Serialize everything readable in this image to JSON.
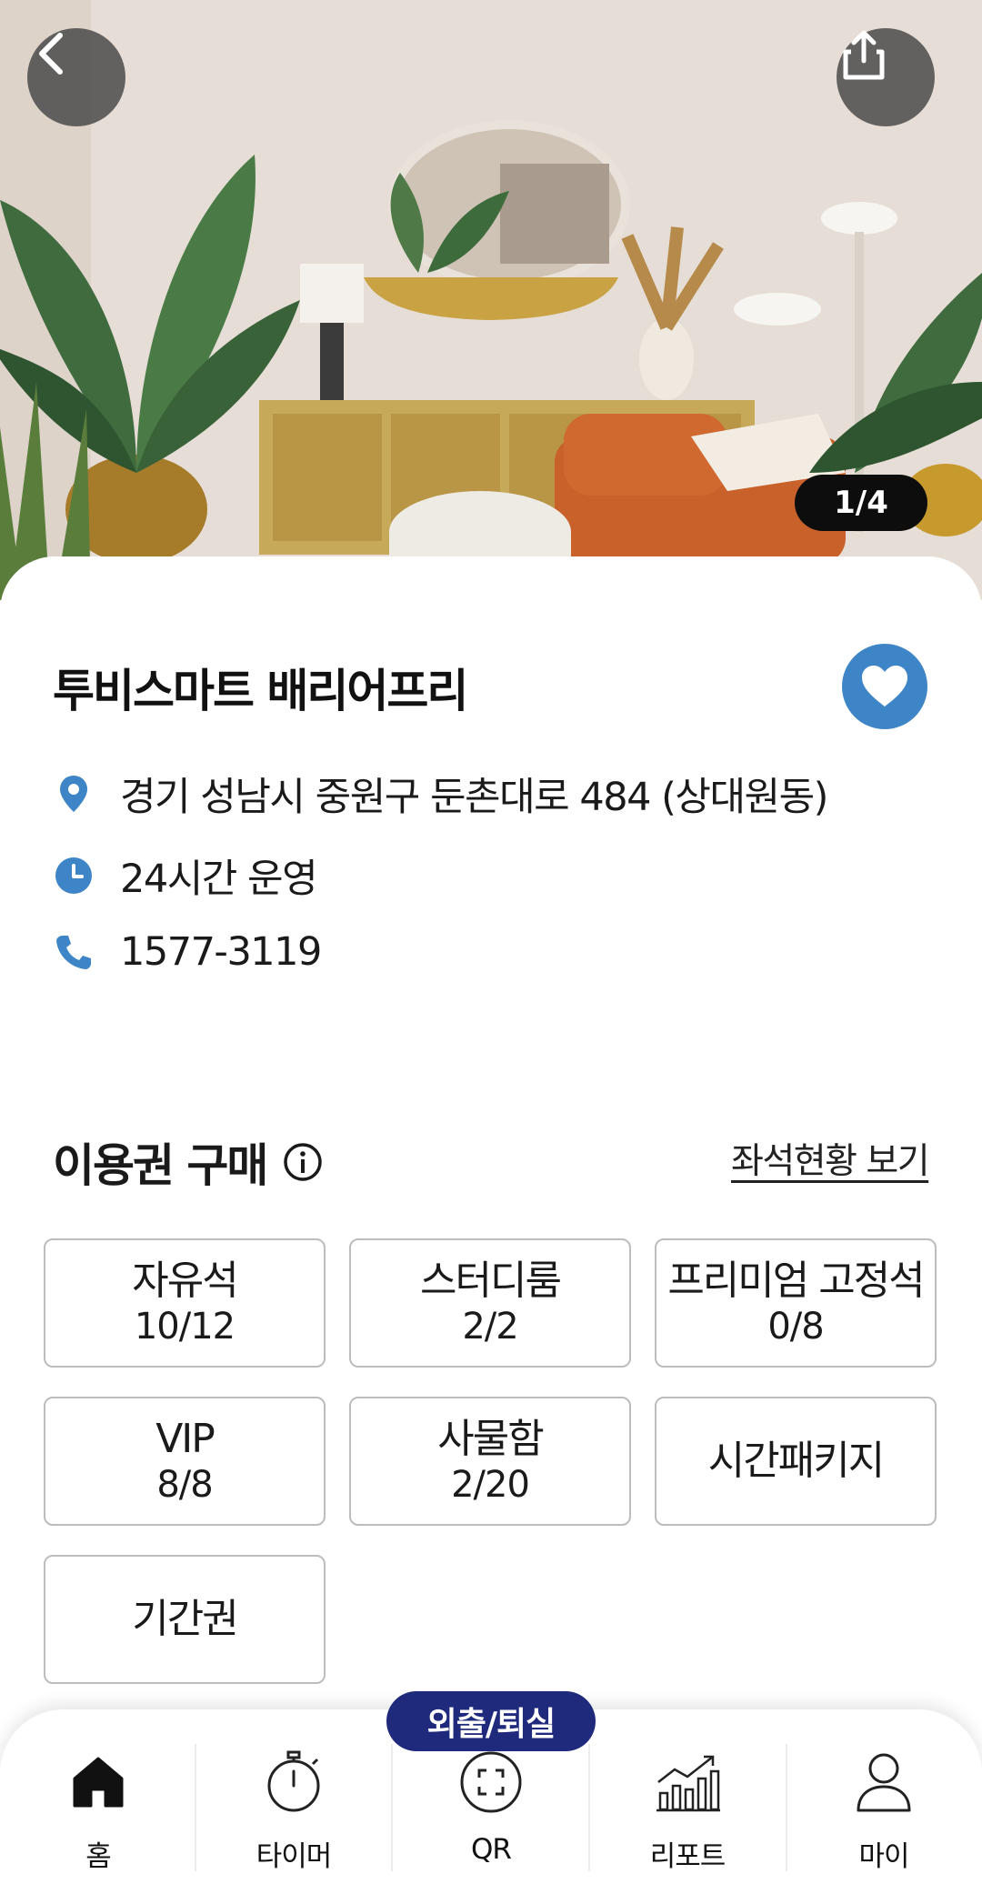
{
  "hero": {
    "page_indicator": "1/4",
    "icons": {
      "back": "chevron-left-icon",
      "share": "share-icon"
    }
  },
  "store": {
    "name": "투비스마트 배리어프리",
    "address": "경기 성남시 중원구 둔촌대로 484 (상대원동)",
    "hours": "24시간 운영",
    "phone": "1577-3119",
    "icons": {
      "address": "location-pin-icon",
      "hours": "clock-icon",
      "phone": "phone-icon",
      "favorite": "heart-icon"
    }
  },
  "purchase": {
    "title": "이용권 구매",
    "seat_status_link": "좌석현황 보기",
    "tickets": [
      {
        "name": "자유석",
        "count": "10/12"
      },
      {
        "name": "스터디룸",
        "count": "2/2"
      },
      {
        "name": "프리미엄 고정석",
        "count": "0/8"
      },
      {
        "name": "VIP",
        "count": "8/8"
      },
      {
        "name": "사물함",
        "count": "2/20"
      },
      {
        "name": "시간패키지",
        "count": ""
      },
      {
        "name": "기간권",
        "count": ""
      }
    ]
  },
  "nav": {
    "outing_button": "외출/퇴실",
    "items": [
      {
        "label": "홈",
        "icon": "home-icon"
      },
      {
        "label": "타이머",
        "icon": "stopwatch-icon"
      },
      {
        "label": "QR",
        "icon": "qr-scan-icon"
      },
      {
        "label": "리포트",
        "icon": "chart-icon"
      },
      {
        "label": "마이",
        "icon": "user-icon"
      }
    ]
  },
  "colors": {
    "accent_blue": "#3d85c6",
    "outing_button": "#1f2a7c",
    "indicator_bg": "#0d0d0d",
    "tile_border": "#bdbdbd"
  }
}
